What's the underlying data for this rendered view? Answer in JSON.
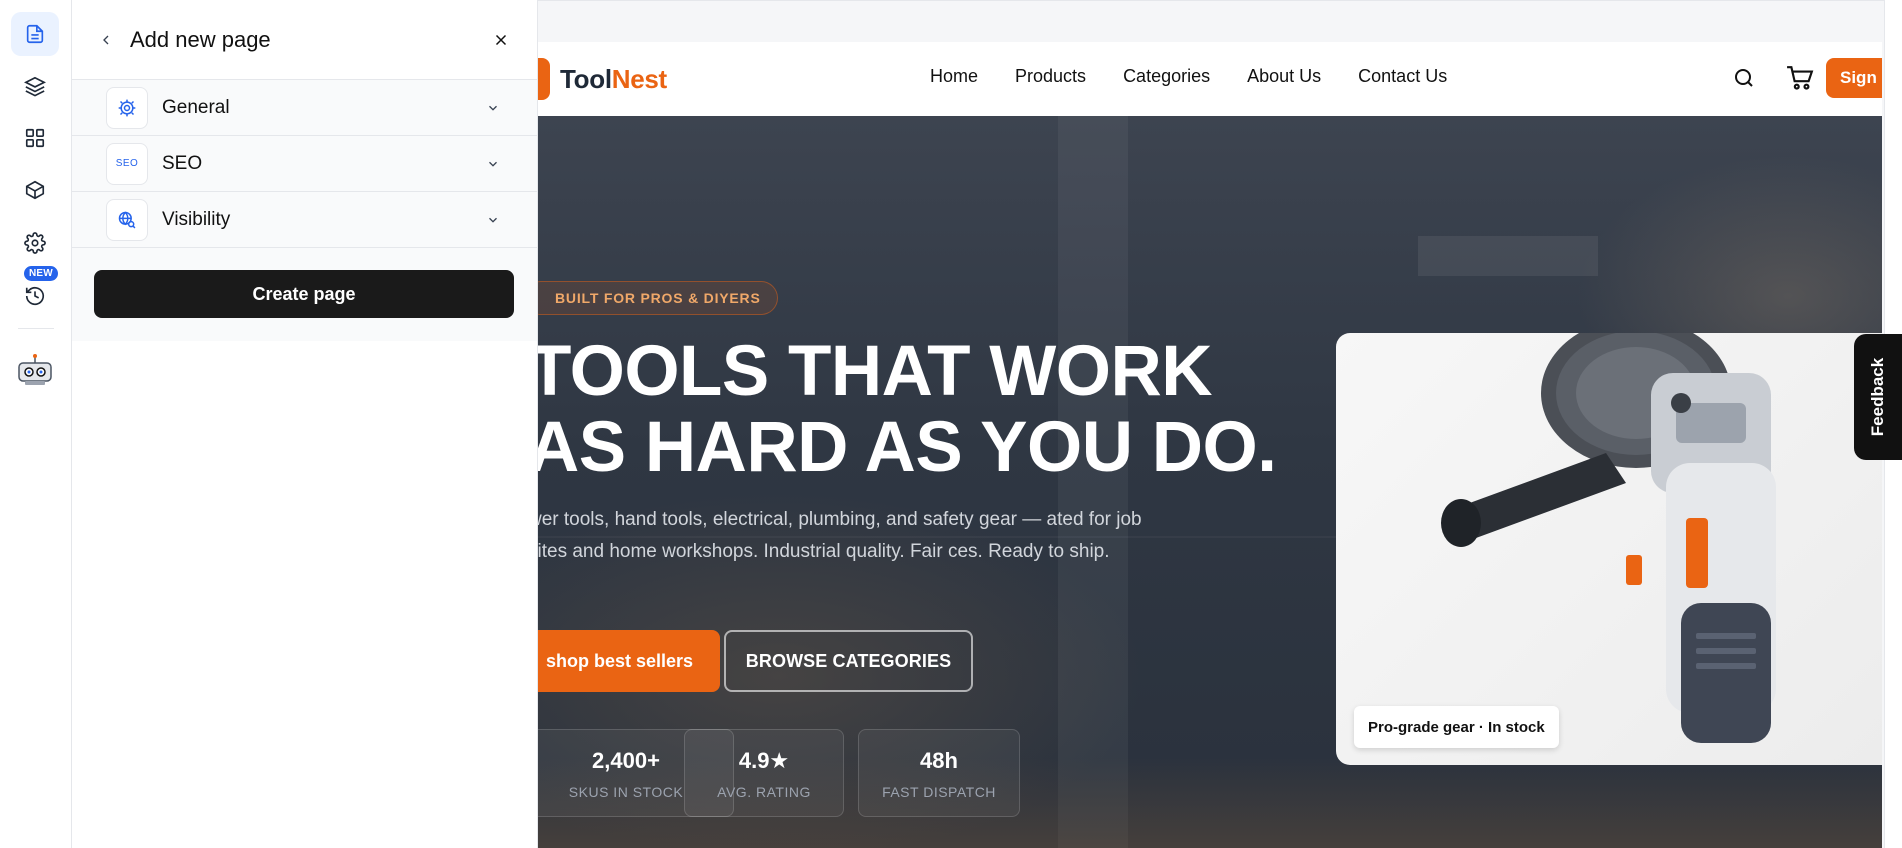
{
  "rail": {
    "items": [
      {
        "icon": "page-icon",
        "active": true
      },
      {
        "icon": "layers-icon"
      },
      {
        "icon": "grid-icon"
      },
      {
        "icon": "box-icon"
      },
      {
        "icon": "gear-icon"
      },
      {
        "icon": "history-icon"
      }
    ],
    "new_badge": "NEW"
  },
  "panel": {
    "title": "Add new page",
    "sections": [
      {
        "label": "General",
        "icon": "gear-icon"
      },
      {
        "label": "SEO",
        "icon": "seo-icon",
        "icon_text": "SEO"
      },
      {
        "label": "Visibility",
        "icon": "globe-search-icon"
      }
    ],
    "create_label": "Create page"
  },
  "site": {
    "brand": {
      "part1": "Tool",
      "part2": "Nest",
      "accent_color": "#ea6413"
    },
    "nav": [
      "Home",
      "Products",
      "Categories",
      "About Us",
      "Contact Us"
    ],
    "sign_label": "Sign",
    "hero": {
      "badge": "BUILT FOR PROS & DIYERS",
      "headline_line1": "TOOLS THAT WORK",
      "headline_line2": "AS HARD AS YOU DO.",
      "description": "wer tools, hand tools, electrical, plumbing, and safety gear — ated for job sites and home workshops. Industrial quality. Fair ces. Ready to ship.",
      "shop_label": "shop best sellers",
      "browse_label": "BROWSE CATEGORIES",
      "stats": [
        {
          "value": "2,400+",
          "label": "SKUS IN STOCK"
        },
        {
          "value": "4.9★",
          "label": "AVG. RATING"
        },
        {
          "value": "48h",
          "label": "FAST DISPATCH"
        }
      ],
      "product_tag": "Pro-grade gear · In stock"
    },
    "feedback_label": "Feedback"
  }
}
